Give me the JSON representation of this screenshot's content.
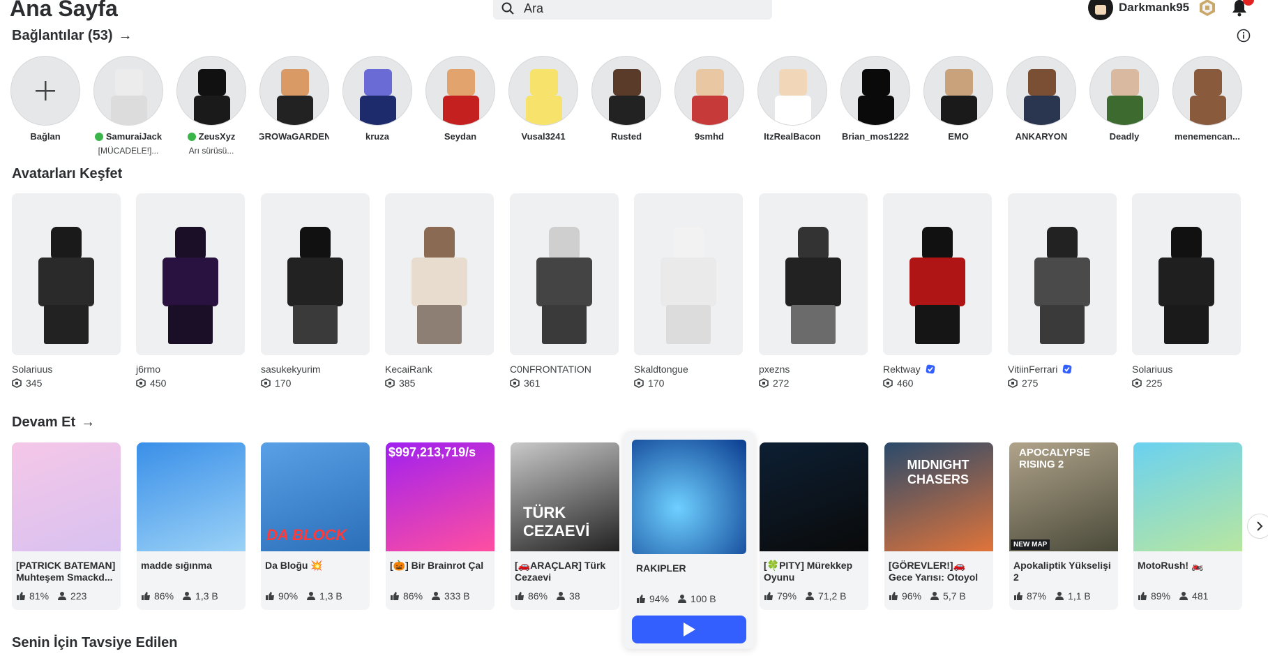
{
  "header": {
    "page_title": "Ana Sayfa",
    "search_placeholder": "Ara",
    "username": "Darkmank95"
  },
  "connections": {
    "title": "Bağlantılar (53)",
    "add_label": "Bağlan",
    "items": [
      {
        "name": "SamuraiJack",
        "status": "[MÜCADELE!]...",
        "online": true
      },
      {
        "name": "ZeusXyz",
        "status": "Arı sürüsü...",
        "online": true
      },
      {
        "name": "GROWaGARDEN",
        "status": "",
        "online": false
      },
      {
        "name": "kruza",
        "status": "",
        "online": false
      },
      {
        "name": "Seydan",
        "status": "",
        "online": false
      },
      {
        "name": "Vusal3241",
        "status": "",
        "online": false
      },
      {
        "name": "Rusted",
        "status": "",
        "online": false
      },
      {
        "name": "9smhd",
        "status": "",
        "online": false
      },
      {
        "name": "ItzRealBacon",
        "status": "",
        "online": false
      },
      {
        "name": "Brian_mos1222",
        "status": "",
        "online": false
      },
      {
        "name": "EMO",
        "status": "",
        "online": false
      },
      {
        "name": "ANKARYON",
        "status": "",
        "online": false
      },
      {
        "name": "Deadly",
        "status": "",
        "online": false
      },
      {
        "name": "menemencan...",
        "status": "",
        "online": false
      }
    ]
  },
  "explore_avatars": {
    "title": "Avatarları Keşfet",
    "items": [
      {
        "name": "Solariuus",
        "price": "345",
        "verified": false
      },
      {
        "name": "j6rmo",
        "price": "450",
        "verified": false
      },
      {
        "name": "sasukekyurim",
        "price": "170",
        "verified": false
      },
      {
        "name": "KecaiRank",
        "price": "385",
        "verified": false
      },
      {
        "name": "C0NFRONTATION",
        "price": "361",
        "verified": false
      },
      {
        "name": "Skaldtongue",
        "price": "170",
        "verified": false
      },
      {
        "name": "pxezns",
        "price": "272",
        "verified": false
      },
      {
        "name": "Rektway",
        "price": "460",
        "verified": true
      },
      {
        "name": "VitiinFerrari",
        "price": "275",
        "verified": true
      },
      {
        "name": "Solariuus",
        "price": "225",
        "verified": false
      }
    ]
  },
  "continue": {
    "title": "Devam Et",
    "items": [
      {
        "title": "[PATRICK BATEMAN] Muhteşem Smackd...",
        "rating": "81%",
        "players": "223"
      },
      {
        "title": "madde sığınma",
        "rating": "86%",
        "players": "1,3 B"
      },
      {
        "title": "Da Bloğu 💥",
        "rating": "90%",
        "players": "1,3 B"
      },
      {
        "title": "[🎃] Bir Brainrot Çal",
        "rating": "86%",
        "players": "333 B"
      },
      {
        "title": "[🚗ARAÇLAR] Türk Cezaevi",
        "rating": "86%",
        "players": "38"
      },
      {
        "title": "RAKIPLER",
        "rating": "94%",
        "players": "100 B"
      },
      {
        "title": "[🍀PITY] Mürekkep Oyunu",
        "rating": "79%",
        "players": "71,2 B"
      },
      {
        "title": "[GÖREVLER!]🚗Gece Yarısı: Otoyol Yarışı",
        "rating": "96%",
        "players": "5,7 B"
      },
      {
        "title": "Apokaliptik Yükselişi 2",
        "rating": "87%",
        "players": "1,1 B"
      },
      {
        "title": "MotoRush! 🏍️",
        "rating": "89%",
        "players": "481"
      }
    ],
    "thumb_texts": {
      "g3": "DA BLOCK",
      "g4": "$997,213,719/s",
      "g5": "TÜRK CEZAEVİ",
      "g8": "MIDNIGHT CHASERS",
      "g9": "APOCALYPSE RISING 2",
      "g9_badge": "NEW MAP"
    }
  },
  "recommended": {
    "title": "Senin İçin Tavsiye Edilen"
  },
  "colors": {
    "accent": "#335fff",
    "online": "#3ab54a",
    "badge": "#e32222"
  }
}
